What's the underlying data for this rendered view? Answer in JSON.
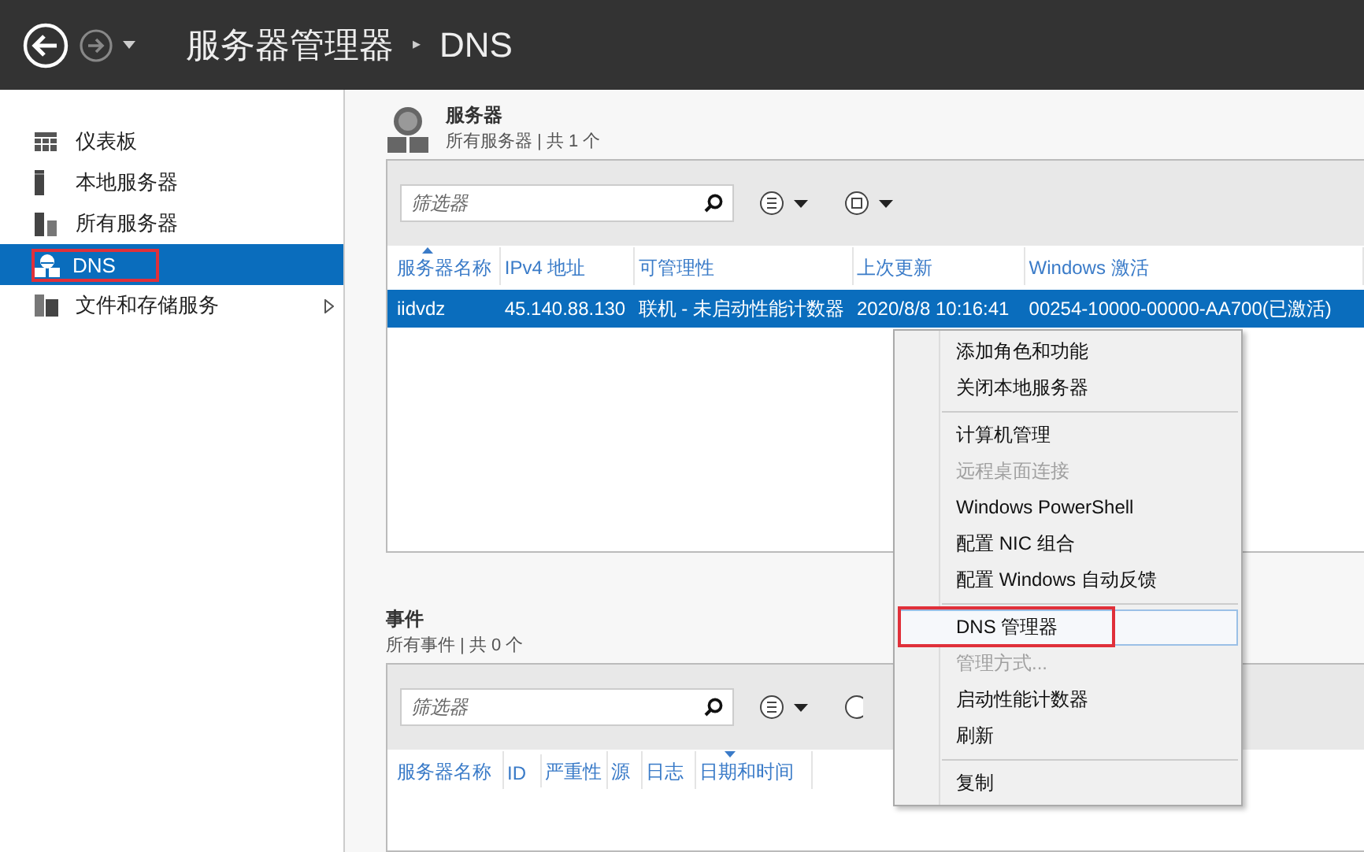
{
  "header": {
    "title": "服务器管理器",
    "separator": "▸",
    "page": "DNS"
  },
  "sidebar": {
    "items": [
      {
        "kind": "dashboard",
        "label": "仪表板",
        "selected": false,
        "highlighted": false,
        "has_submenu": false
      },
      {
        "kind": "server",
        "label": "本地服务器",
        "selected": false,
        "highlighted": false,
        "has_submenu": false
      },
      {
        "kind": "servers",
        "label": "所有服务器",
        "selected": false,
        "highlighted": false,
        "has_submenu": false
      },
      {
        "kind": "dns",
        "label": "DNS",
        "selected": true,
        "highlighted": true,
        "has_submenu": false
      },
      {
        "kind": "storage",
        "label": "文件和存储服务",
        "selected": false,
        "highlighted": false,
        "has_submenu": true
      }
    ]
  },
  "servers": {
    "title": "服务器",
    "subtitle": "所有服务器 | 共 1 个",
    "filter": {
      "placeholder": "筛选器"
    },
    "columns": [
      {
        "label": "服务器名称",
        "sorted": true
      },
      {
        "label": "IPv4 地址",
        "sorted": false
      },
      {
        "label": "可管理性",
        "sorted": false
      },
      {
        "label": "上次更新",
        "sorted": false
      },
      {
        "label": "Windows 激活",
        "sorted": false
      }
    ],
    "rows": [
      {
        "selected": true,
        "cells": [
          "iidvdz",
          "45.140.88.130",
          "联机 - 未启动性能计数器",
          "2020/8/8 10:16:41",
          "00254-10000-00000-AA700(已激活)"
        ]
      }
    ]
  },
  "events": {
    "title": "事件",
    "subtitle": "所有事件 | 共 0 个",
    "filter": {
      "placeholder": "筛选器"
    },
    "columns": [
      {
        "label": "服务器名称",
        "sorted": false
      },
      {
        "label": "ID",
        "sorted": false
      },
      {
        "label": "严重性",
        "sorted": false
      },
      {
        "label": "源",
        "sorted": false
      },
      {
        "label": "日志",
        "sorted": false
      },
      {
        "label": "日期和时间",
        "sorted": true
      }
    ]
  },
  "context_menu": {
    "groups": [
      [
        {
          "label": "添加角色和功能",
          "disabled": false,
          "hovered": false,
          "highlighted": false
        },
        {
          "label": "关闭本地服务器",
          "disabled": false,
          "hovered": false,
          "highlighted": false
        }
      ],
      [
        {
          "label": "计算机管理",
          "disabled": false,
          "hovered": false,
          "highlighted": false
        },
        {
          "label": "远程桌面连接",
          "disabled": true,
          "hovered": false,
          "highlighted": false
        },
        {
          "label": "Windows PowerShell",
          "disabled": false,
          "hovered": false,
          "highlighted": false
        },
        {
          "label": "配置 NIC 组合",
          "disabled": false,
          "hovered": false,
          "highlighted": false
        },
        {
          "label": "配置 Windows 自动反馈",
          "disabled": false,
          "hovered": false,
          "highlighted": false
        }
      ],
      [
        {
          "label": "DNS 管理器",
          "disabled": false,
          "hovered": true,
          "highlighted": true
        },
        {
          "label": "管理方式...",
          "disabled": true,
          "hovered": false,
          "highlighted": false
        },
        {
          "label": "启动性能计数器",
          "disabled": false,
          "hovered": false,
          "highlighted": false
        },
        {
          "label": "刷新",
          "disabled": false,
          "hovered": false,
          "highlighted": false
        }
      ],
      [
        {
          "label": "复制",
          "disabled": false,
          "hovered": false,
          "highlighted": false
        }
      ]
    ]
  }
}
